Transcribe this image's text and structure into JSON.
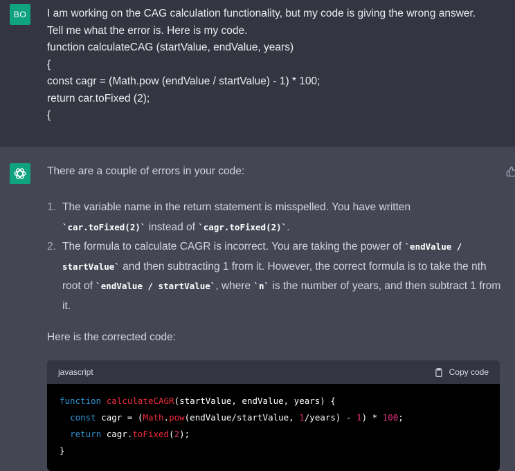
{
  "user": {
    "avatar_initials": "BO",
    "message_lines": [
      "I am working on the CAG calculation functionality, but my code is giving the wrong answer.",
      "Tell me what the error is. Here is my code.",
      "function calculateCAG (startValue, endValue, years)",
      "{",
      "const cagr = (Math.pow (endValue / startValue) - 1) * 100;",
      "return car.toFixed (2);",
      "{"
    ]
  },
  "assistant": {
    "intro": "There are a couple of errors in your code:",
    "items": [
      {
        "num": "1.",
        "t1": "The variable name in the return statement is misspelled. You have written",
        "c1": "`car.toFixed(2)`",
        "t2": " instead of ",
        "c2": "`cagr.toFixed(2)`",
        "t3": "."
      },
      {
        "num": "2.",
        "t1": "The formula to calculate CAGR is incorrect. You are taking the power of ",
        "c1": "`endValue / startValue`",
        "t2": " and then subtracting 1 from it. However, the correct formula is to take the nth root of ",
        "c2": "`endValue / startValue`",
        "t3": ", where ",
        "c3": "`n`",
        "t4": " is the number of years, and then subtract 1 from it."
      }
    ],
    "outro": "Here is the corrected code:",
    "code": {
      "language": "javascript",
      "copy_label": "Copy code",
      "line1": {
        "kw": "function",
        "fn": "calculateCAGR",
        "rest": "(startValue, endValue, years) {"
      },
      "line2": {
        "kw": "const",
        "a": " cagr = (",
        "builtin": "Math",
        "dot": ".",
        "fn": "pow",
        "b": "(endValue/startValue, ",
        "n1": "1",
        "c": "/years) - ",
        "n2": "1",
        "d": ") * ",
        "n3": "100",
        "e": ";"
      },
      "line3": {
        "kw": "return",
        "a": " cagr.",
        "fn": "toFixed",
        "b": "(",
        "n1": "2",
        "c": ");"
      },
      "line4": "}"
    }
  },
  "colors": {
    "user_bg": "#343541",
    "assistant_bg": "#444654",
    "accent": "#10a37f"
  },
  "icons": [
    "openai-logo-icon",
    "thumbs-up-icon",
    "clipboard-icon"
  ]
}
